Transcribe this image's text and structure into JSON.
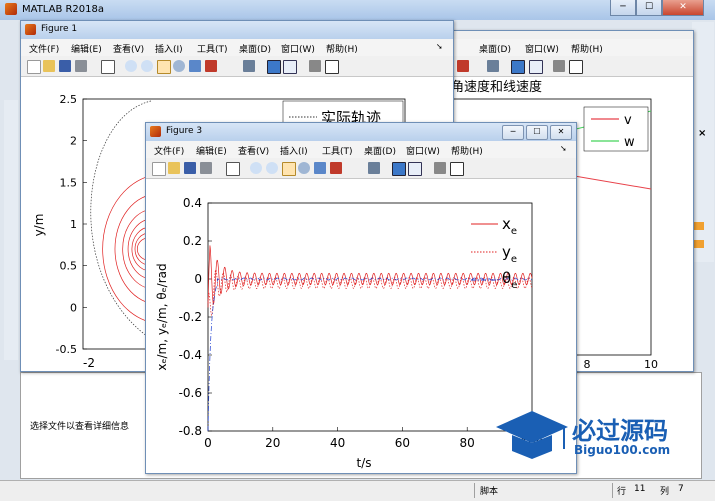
{
  "main": {
    "title": "MATLAB R2018a",
    "select_file_msg": "选择文件以查看详细信息",
    "status": {
      "script_label": "脚本",
      "row_label": "行",
      "row": "11",
      "col_label": "列",
      "col": "7"
    },
    "min_symbol": "─",
    "max_symbol": "☐",
    "close_symbol": "✕"
  },
  "fig1": {
    "title": "Figure 1",
    "menu": [
      "文件(F)",
      "编辑(E)",
      "查看(V)",
      "插入(I)",
      "工具(T)",
      "桌面(D)",
      "窗口(W)",
      "帮助(H)"
    ],
    "chart_data": {
      "type": "line",
      "ylabel": "y/m",
      "yticks": [
        "2.5",
        "2",
        "1.5",
        "1",
        "0.5",
        "0",
        "-0.5"
      ],
      "xticks": [
        "-2"
      ],
      "legend": [
        "实际轨迹"
      ]
    }
  },
  "fig2": {
    "menu": [
      "桌面(D)",
      "窗口(W)",
      "帮助(H)"
    ],
    "chart_data": {
      "type": "line",
      "title": "角速度和线速度",
      "xticks": [
        "8",
        "10"
      ],
      "legend": [
        "v",
        "w"
      ],
      "series_colors": [
        "#e8424a",
        "#44d35a"
      ]
    }
  },
  "fig3": {
    "title": "Figure 3",
    "menu": [
      "文件(F)",
      "编辑(E)",
      "查看(V)",
      "插入(I)",
      "工具(T)",
      "桌面(D)",
      "窗口(W)",
      "帮助(H)"
    ],
    "chart_data": {
      "type": "line",
      "xlabel": "t/s",
      "ylabel": "xₑ/m, yₑ/m, θₑ/rad",
      "xticks": [
        "0",
        "20",
        "40",
        "60",
        "80",
        "100"
      ],
      "yticks": [
        "0.4",
        "0.2",
        "0",
        "-0.2",
        "-0.4",
        "-0.6",
        "-0.8"
      ],
      "xlim": [
        0,
        100
      ],
      "ylim": [
        -0.8,
        0.4
      ],
      "legend": [
        {
          "name": "x",
          "sub": "e"
        },
        {
          "name": "y",
          "sub": "e"
        },
        {
          "name": "θ",
          "sub": "e"
        }
      ],
      "series_colors": [
        "#e02020",
        "#e02020",
        "#1f3fd0"
      ]
    }
  },
  "watermark": {
    "logo_text": "必过源码",
    "url": "Biguo100.com"
  }
}
